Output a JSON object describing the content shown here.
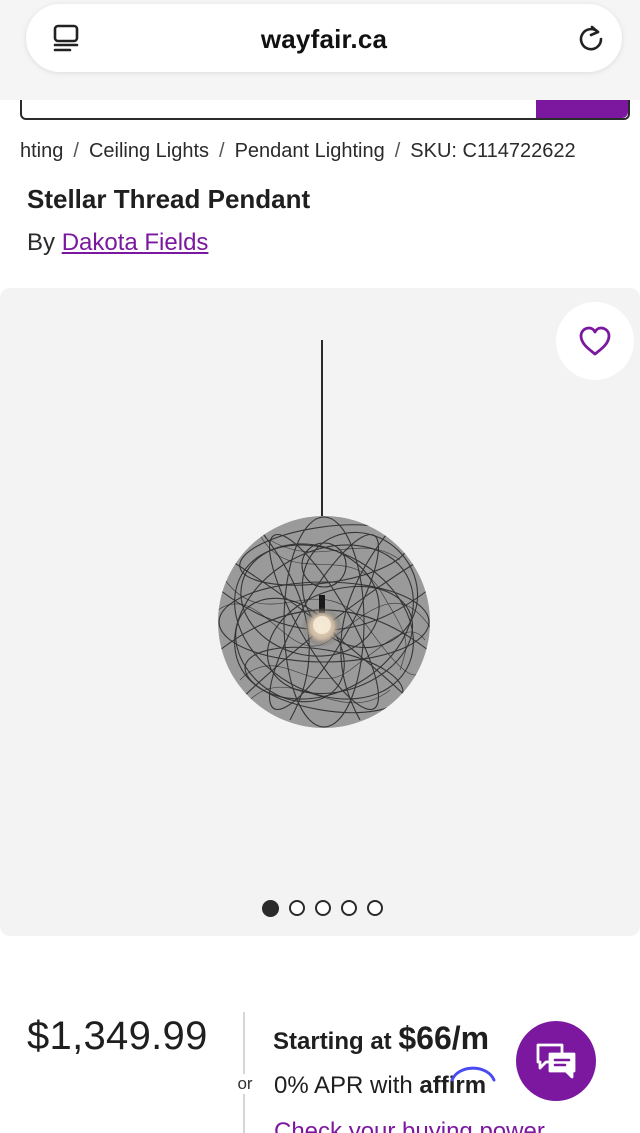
{
  "browser": {
    "url": "wayfair.ca"
  },
  "breadcrumb": {
    "items": [
      "hting",
      "Ceiling Lights",
      "Pendant Lighting",
      "SKU: C114722622"
    ],
    "separator": "/"
  },
  "product": {
    "title": "Stellar Thread Pendant",
    "by_prefix": "By",
    "brand": "Dakota Fields",
    "image_icon": "pendant-lamp-image",
    "gallery": {
      "total_images": 5,
      "active_index": 1
    }
  },
  "pricing": {
    "price": "$1,349.99",
    "or": "or",
    "starting_prefix": "Starting at",
    "monthly": "$66/m",
    "apr_text": "0% APR with",
    "affirm": "affirm",
    "check_link": "Check your buying power"
  },
  "colors": {
    "brand_purple": "#7b189f",
    "gallery_bg": "#f3f3f3"
  },
  "icons": {
    "tabs": "tabs-icon",
    "reload": "reload-icon",
    "favorite": "heart-icon",
    "chat": "chat-icon"
  }
}
